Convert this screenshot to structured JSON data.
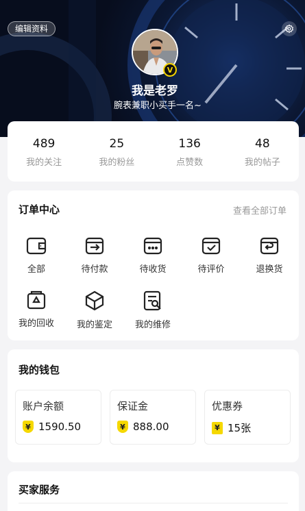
{
  "header": {
    "edit_label": "编辑资料",
    "nickname": "我是老罗",
    "bio": "腕表兼职小买手一名~",
    "badge_letter": "V"
  },
  "stats": [
    {
      "value": "489",
      "label": "我的关注"
    },
    {
      "value": "25",
      "label": "我的粉丝"
    },
    {
      "value": "136",
      "label": "点赞数"
    },
    {
      "value": "48",
      "label": "我的帖子"
    }
  ],
  "orders": {
    "title": "订单中心",
    "view_all": "查看全部订单",
    "items": [
      {
        "label": "全部",
        "icon": "wallet-icon"
      },
      {
        "label": "待付款",
        "icon": "pay-icon"
      },
      {
        "label": "待收货",
        "icon": "receive-icon"
      },
      {
        "label": "待评价",
        "icon": "review-icon"
      },
      {
        "label": "退换货",
        "icon": "return-icon"
      },
      {
        "label": "我的回收",
        "icon": "recycle-icon"
      },
      {
        "label": "我的鉴定",
        "icon": "appraise-icon"
      },
      {
        "label": "我的维修",
        "icon": "repair-icon"
      }
    ]
  },
  "wallet": {
    "title": "我的钱包",
    "items": [
      {
        "title": "账户余额",
        "value": "1590.50"
      },
      {
        "title": "保证金",
        "value": "888.00"
      },
      {
        "title": "优惠券",
        "value": "15张"
      }
    ],
    "currency_symbol": "¥"
  },
  "buyer": {
    "title": "买家服务"
  },
  "colors": {
    "accent": "#f5d800",
    "header_bg": "#0b1732"
  }
}
